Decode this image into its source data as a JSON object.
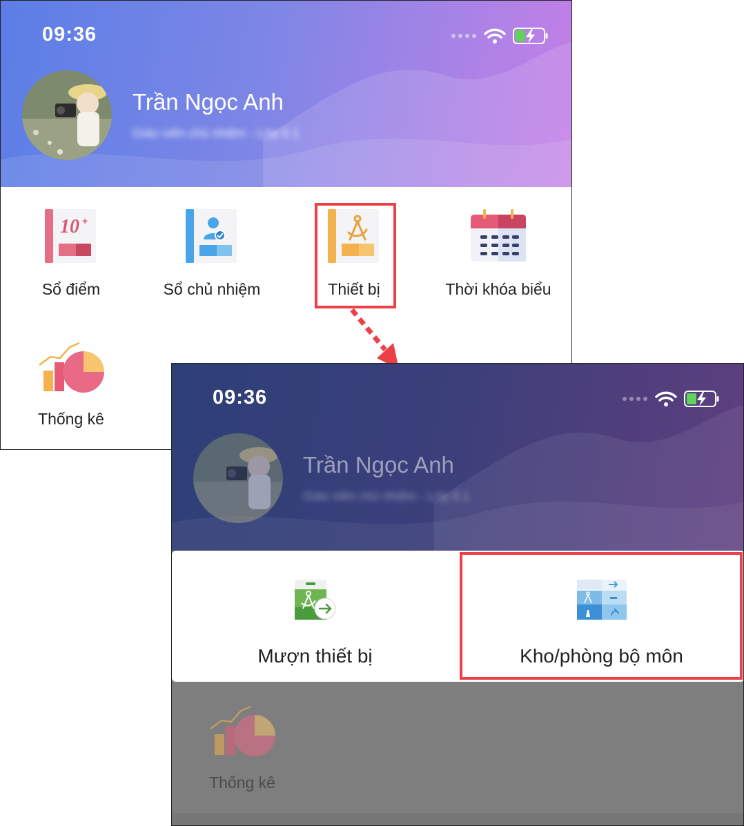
{
  "screen1": {
    "status_time": "09:36",
    "user_name": "Trần Ngọc Anh",
    "user_subtitle": "Giáo viên chủ nhiệm - Lớp 6.1",
    "menu": [
      {
        "label": "Sổ điểm",
        "icon": "gradebook-icon"
      },
      {
        "label": "Sổ chủ nhiệm",
        "icon": "homeroom-book-icon"
      },
      {
        "label": "Thiết bị",
        "icon": "equipment-book-icon"
      },
      {
        "label": "Thời khóa biểu",
        "icon": "calendar-icon"
      },
      {
        "label": "Thống kê",
        "icon": "statistics-chart-icon"
      }
    ]
  },
  "screen2": {
    "status_time": "09:36",
    "user_name": "Trần Ngọc Anh",
    "user_subtitle": "Giáo viên chủ nhiệm - Lớp 6.1",
    "popup": [
      {
        "label": "Mượn thiết bị",
        "icon": "borrow-equipment-icon"
      },
      {
        "label": "Kho/phòng bộ môn",
        "icon": "subject-room-icon"
      }
    ],
    "background_item": {
      "label": "Thống kê",
      "icon": "statistics-chart-icon"
    }
  },
  "colors": {
    "highlight": "#ec3f47",
    "header_light": "#7d86e6",
    "header_dark": "#3a3f7a"
  }
}
